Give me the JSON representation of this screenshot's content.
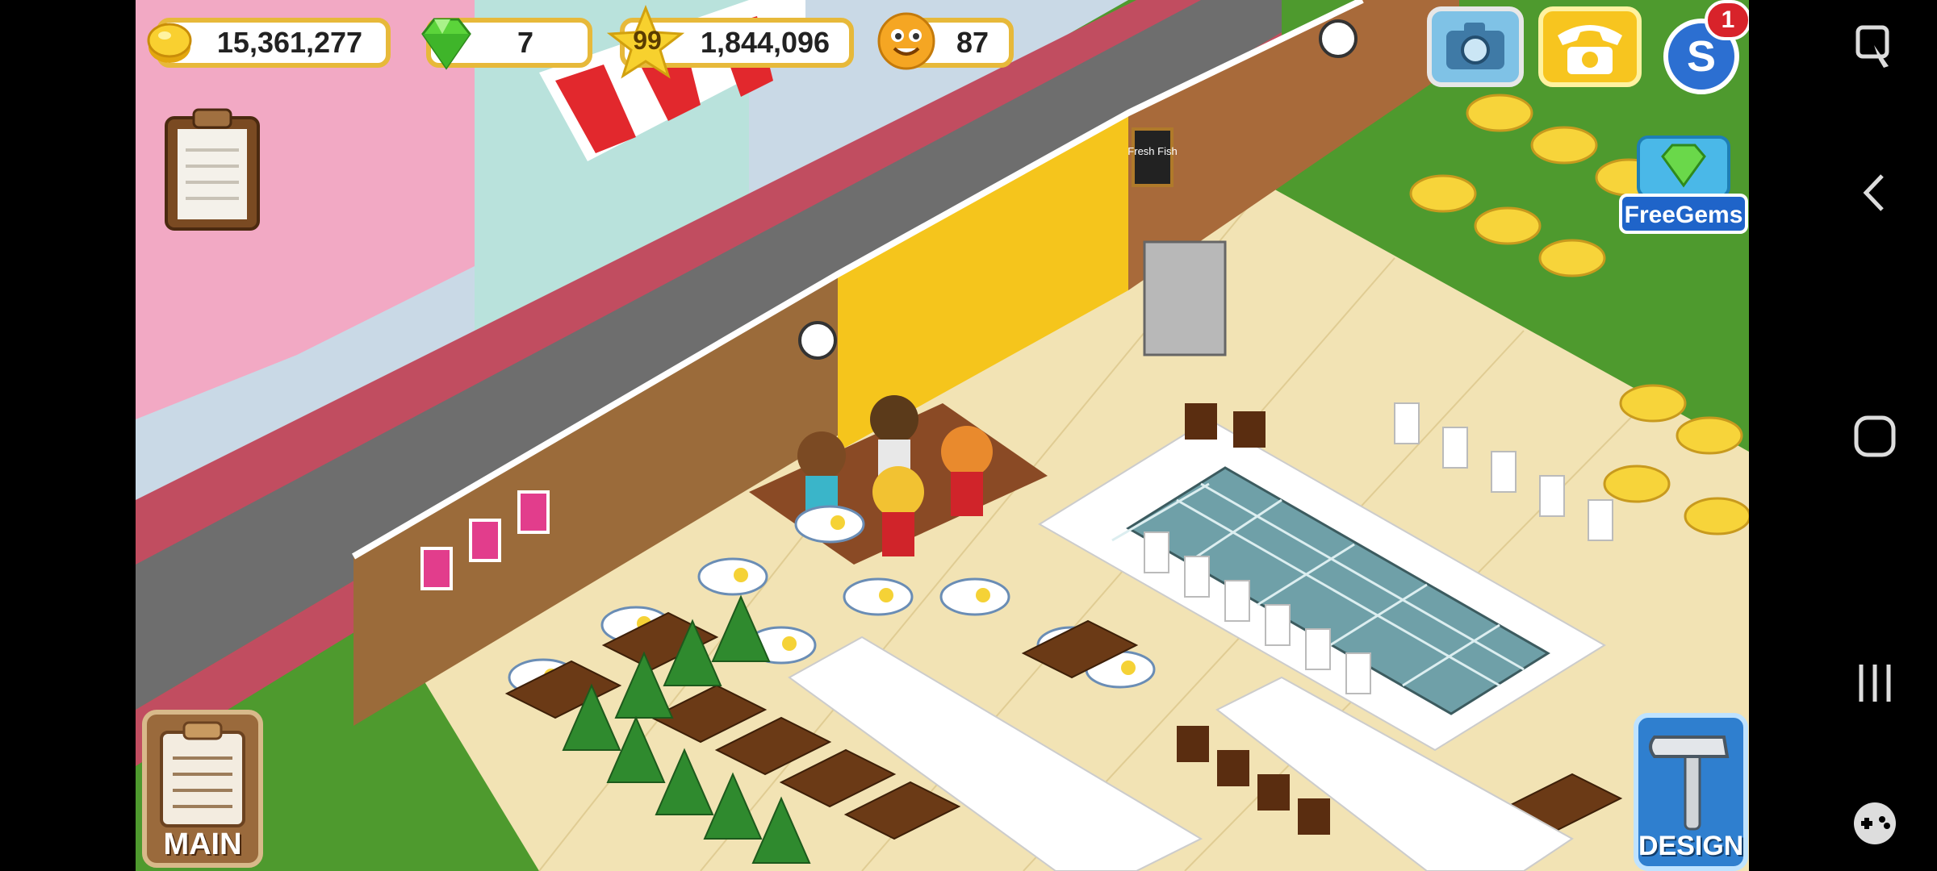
{
  "hud": {
    "coins": "15,361,277",
    "gems": "7",
    "level": "99",
    "experience": "1,844,096",
    "smiles": "87"
  },
  "buttons": {
    "notification_count": "1",
    "free_gems_label": "FreeGems",
    "main_label": "MAIN",
    "design_label": "DESIGN"
  },
  "icons": {
    "coin": "coin-icon",
    "gem": "gem-icon",
    "star": "star-icon",
    "smile": "smile-face-icon",
    "camera": "camera-icon",
    "phone": "phone-icon",
    "social": "social-s-icon",
    "clipboard": "clipboard-icon",
    "hammer": "hammer-icon"
  },
  "scene": {
    "sign_text": "Fresh Fish"
  },
  "colors": {
    "hud_border": "#e7b93a",
    "free_gems_bg": "#1f64c9",
    "floor": "#f2e3b4",
    "wall_yellow": "#f5c51c",
    "road": "#6e6e6e"
  }
}
